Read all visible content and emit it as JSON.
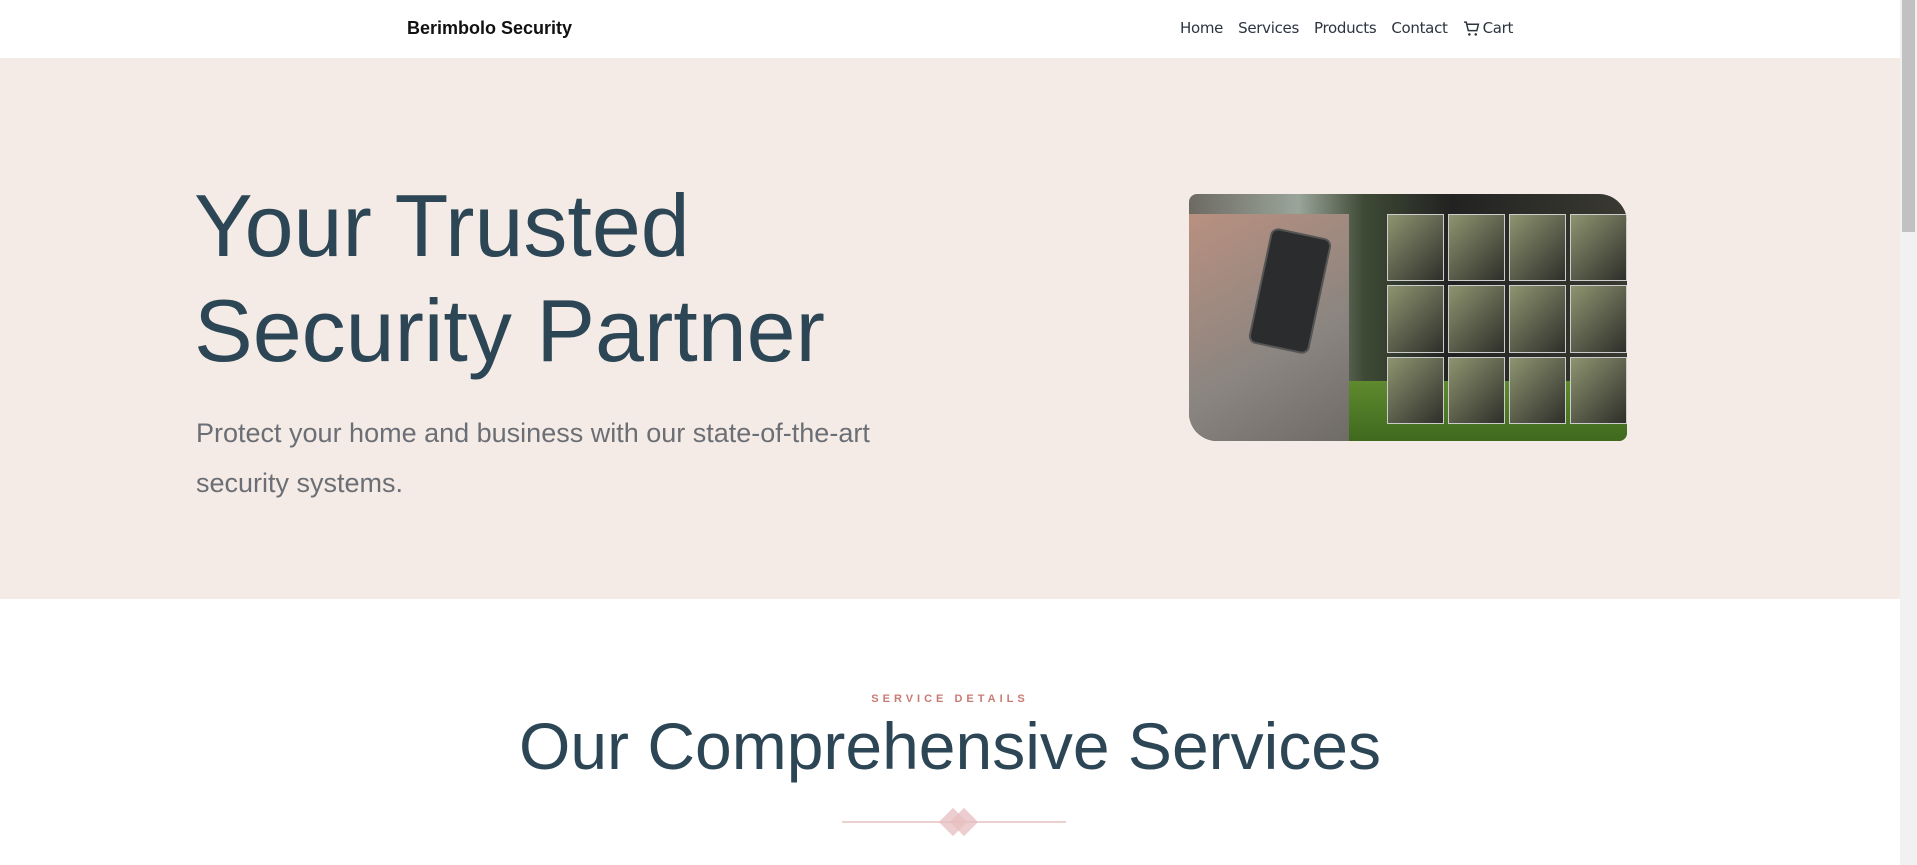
{
  "nav": {
    "brand": "Berimbolo Security",
    "links": [
      "Home",
      "Services",
      "Products",
      "Contact"
    ],
    "cart_label": "Cart",
    "cart_icon": "cart-icon"
  },
  "hero": {
    "title_line1": "Your Trusted",
    "title_line2": "Security Partner",
    "subtitle": "Protect your home and business with our state-of-the-art security systems."
  },
  "services": {
    "eyebrow": "SERVICE DETAILS",
    "title": "Our Comprehensive Services"
  },
  "colors": {
    "hero_bg": "#f4ebe6",
    "heading": "#2d4656",
    "accent": "#c97b73"
  }
}
